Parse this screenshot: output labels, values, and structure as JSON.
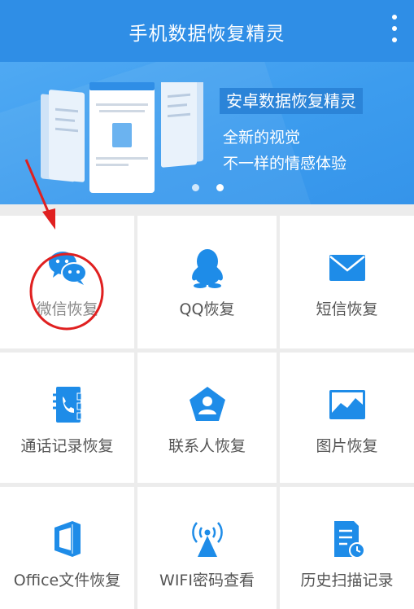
{
  "app": {
    "title": "手机数据恢复精灵",
    "menu_icon": "more-vert-icon"
  },
  "banner": {
    "headline": "安卓数据恢复精灵",
    "line1": "全新的视觉",
    "line2": "不一样的情感体验",
    "dots_total": 2,
    "dot_active_color": "#ffffff",
    "dot_inactive_color": "#ffffff"
  },
  "grid": {
    "items": [
      {
        "label": "微信恢复",
        "icon": "wechat-icon"
      },
      {
        "label": "QQ恢复",
        "icon": "qq-penguin-icon"
      },
      {
        "label": "短信恢复",
        "icon": "envelope-icon"
      },
      {
        "label": "通话记录恢复",
        "icon": "call-log-icon"
      },
      {
        "label": "联系人恢复",
        "icon": "contact-icon"
      },
      {
        "label": "图片恢复",
        "icon": "picture-icon"
      },
      {
        "label": "Office文件恢复",
        "icon": "office-icon"
      },
      {
        "label": "WIFI密码查看",
        "icon": "wifi-tower-icon"
      },
      {
        "label": "历史扫描记录",
        "icon": "history-doc-icon"
      }
    ]
  },
  "colors": {
    "primary": "#2f8ee6",
    "icon_blue": "#1e8ce8",
    "annotation_red": "#e02020"
  }
}
